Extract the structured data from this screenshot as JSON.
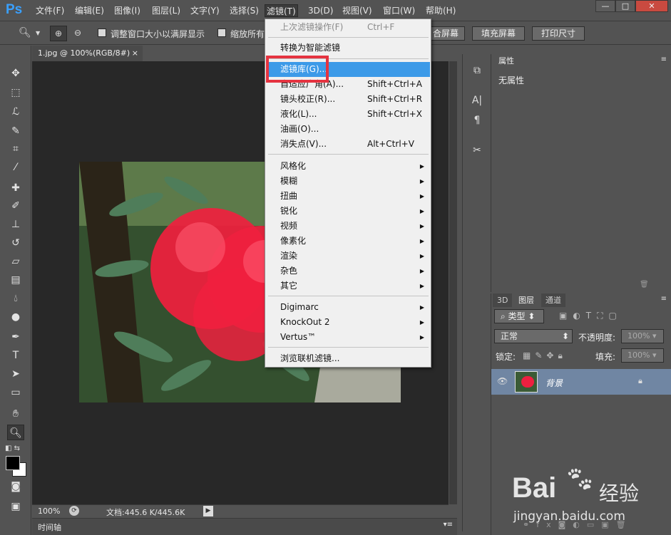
{
  "app": {
    "logo": "Ps"
  },
  "menubar": [
    "文件(F)",
    "编辑(E)",
    "图像(I)",
    "图层(L)",
    "文字(Y)",
    "选择(S)",
    "滤镜(T)",
    "3D(D)",
    "视图(V)",
    "窗口(W)",
    "帮助(H)"
  ],
  "window_controls": {
    "minimize": "—",
    "maximize": "□",
    "close": "✕"
  },
  "options": {
    "resize_windows": "调整窗口大小以满屏显示",
    "zoom_all": "缩放所有",
    "fit_screen": "合屏幕",
    "fill_screen": "填充屏幕",
    "print_size": "打印尺寸"
  },
  "document": {
    "tab": "1.jpg @ 100%(RGB/8#)",
    "tab_close": "×",
    "zoom": "100%",
    "doc_info": "文档:445.6 K/445.6K"
  },
  "timeline": {
    "label": "时间轴"
  },
  "filter_menu": {
    "items": [
      {
        "label": "上次滤镜操作(F)",
        "shortcut": "Ctrl+F",
        "disabled": true
      },
      {
        "label": "转换为智能滤镜"
      },
      {
        "label": "滤镜库(G)...",
        "highlighted": true
      },
      {
        "label": "自适应广角(A)...",
        "shortcut": "Shift+Ctrl+A"
      },
      {
        "label": "镜头校正(R)...",
        "shortcut": "Shift+Ctrl+R"
      },
      {
        "label": "液化(L)...",
        "shortcut": "Shift+Ctrl+X"
      },
      {
        "label": "油画(O)..."
      },
      {
        "label": "消失点(V)...",
        "shortcut": "Alt+Ctrl+V"
      },
      {
        "label": "风格化",
        "submenu": true
      },
      {
        "label": "模糊",
        "submenu": true
      },
      {
        "label": "扭曲",
        "submenu": true
      },
      {
        "label": "锐化",
        "submenu": true
      },
      {
        "label": "视频",
        "submenu": true
      },
      {
        "label": "像素化",
        "submenu": true
      },
      {
        "label": "渲染",
        "submenu": true
      },
      {
        "label": "杂色",
        "submenu": true
      },
      {
        "label": "其它",
        "submenu": true
      },
      {
        "label": "Digimarc",
        "submenu": true
      },
      {
        "label": "KnockOut 2",
        "submenu": true
      },
      {
        "label": "Vertus™",
        "submenu": true
      },
      {
        "label": "浏览联机滤镜..."
      }
    ]
  },
  "properties_panel": {
    "tab": "属性",
    "content": "无属性"
  },
  "layers_panel": {
    "tabs": [
      "3D",
      "图层",
      "通道"
    ],
    "filter_kind": "类型",
    "blend_mode": "正常",
    "opacity_label": "不透明度:",
    "opacity_value": "100%",
    "lock_label": "锁定:",
    "fill_label": "填充:",
    "fill_value": "100%",
    "layer_name": "背景"
  },
  "watermark": {
    "brand": "Bai",
    "brand2": "经验",
    "url": "jingyan.baidu.com"
  },
  "colors": {
    "accent": "#3c9ae8",
    "highlight_box": "#e53340",
    "layer_selected": "#7086a3"
  }
}
